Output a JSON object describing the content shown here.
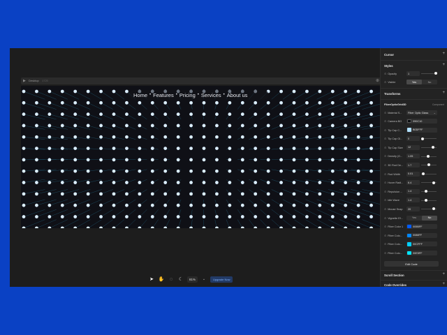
{
  "canvas": {
    "frame_name": "Desktop",
    "frame_size": "1720",
    "nav": [
      "Home",
      "Features",
      "Pricing",
      "Services",
      "About us"
    ]
  },
  "toolbar": {
    "zoom": "81%",
    "upgrade_label": "Upgrade Now",
    "icons": [
      "pointer-icon",
      "hand-icon",
      "comment-icon",
      "moon-icon"
    ]
  },
  "panel": {
    "cursor_title": "Cursor",
    "styles_title": "Styles",
    "opacity_label": "Opacity",
    "opacity_value": "1",
    "visible_label": "Visible",
    "visible_yes": "Yes",
    "visible_no": "No",
    "transforms_title": "Transforms",
    "component_name": "FiberOpticGrid3D",
    "component_type": "Component",
    "material_label": "Material S...",
    "material_value": "Fiber Optic Glass",
    "props": [
      {
        "label": "Camera BG",
        "type": "color",
        "value": "090C10",
        "color": "#090c10"
      },
      {
        "label": "Tip Cap C...",
        "type": "color",
        "value": "B0DFFF",
        "color": "#b0dfff"
      },
      {
        "label": "Tip Cap Gl...",
        "type": "number",
        "value": "0",
        "slider": 0.0
      },
      {
        "label": "Tip Cap Size",
        "type": "number",
        "value": "12",
        "slider": 0.85
      },
      {
        "label": "Density (G...",
        "type": "number",
        "value": "1.05",
        "slider": 0.45
      },
      {
        "label": "3D Rod De...",
        "type": "number",
        "value": "1.7",
        "slider": 0.5
      },
      {
        "label": "Rod Width",
        "type": "number",
        "value": "0.01",
        "slider": 0.05
      },
      {
        "label": "Hover Radi...",
        "type": "number",
        "value": "6.4",
        "slider": 0.9
      },
      {
        "label": "Repulsion ...",
        "type": "number",
        "value": "1.4",
        "slider": 0.3
      },
      {
        "label": "Idle Wave",
        "type": "number",
        "value": "1.4",
        "slider": 0.3
      },
      {
        "label": "Mouse Snap",
        "type": "number",
        "value": "20",
        "slider": 0.88
      },
      {
        "label": "Vignette Ef...",
        "type": "toggle",
        "yes": "Yes",
        "no": "No"
      },
      {
        "label": "Fiber Color 1",
        "type": "color",
        "value": "005BFF",
        "color": "#005bff"
      },
      {
        "label": "Fiber Colo...",
        "type": "color",
        "value": "0088FF",
        "color": "#0088ff"
      },
      {
        "label": "Fiber Colo...",
        "type": "color",
        "value": "00CFFF",
        "color": "#00cfff"
      },
      {
        "label": "Fiber Colo...",
        "type": "color",
        "value": "00E5FF",
        "color": "#00e5ff"
      }
    ],
    "edit_code": "Edit Code",
    "scroll_title": "Scroll Section",
    "overrides_title": "Code Overrides"
  },
  "colors": {
    "background": "#0a41c4",
    "dot": "#dbeeff",
    "fiber": "#1f5f7a"
  }
}
